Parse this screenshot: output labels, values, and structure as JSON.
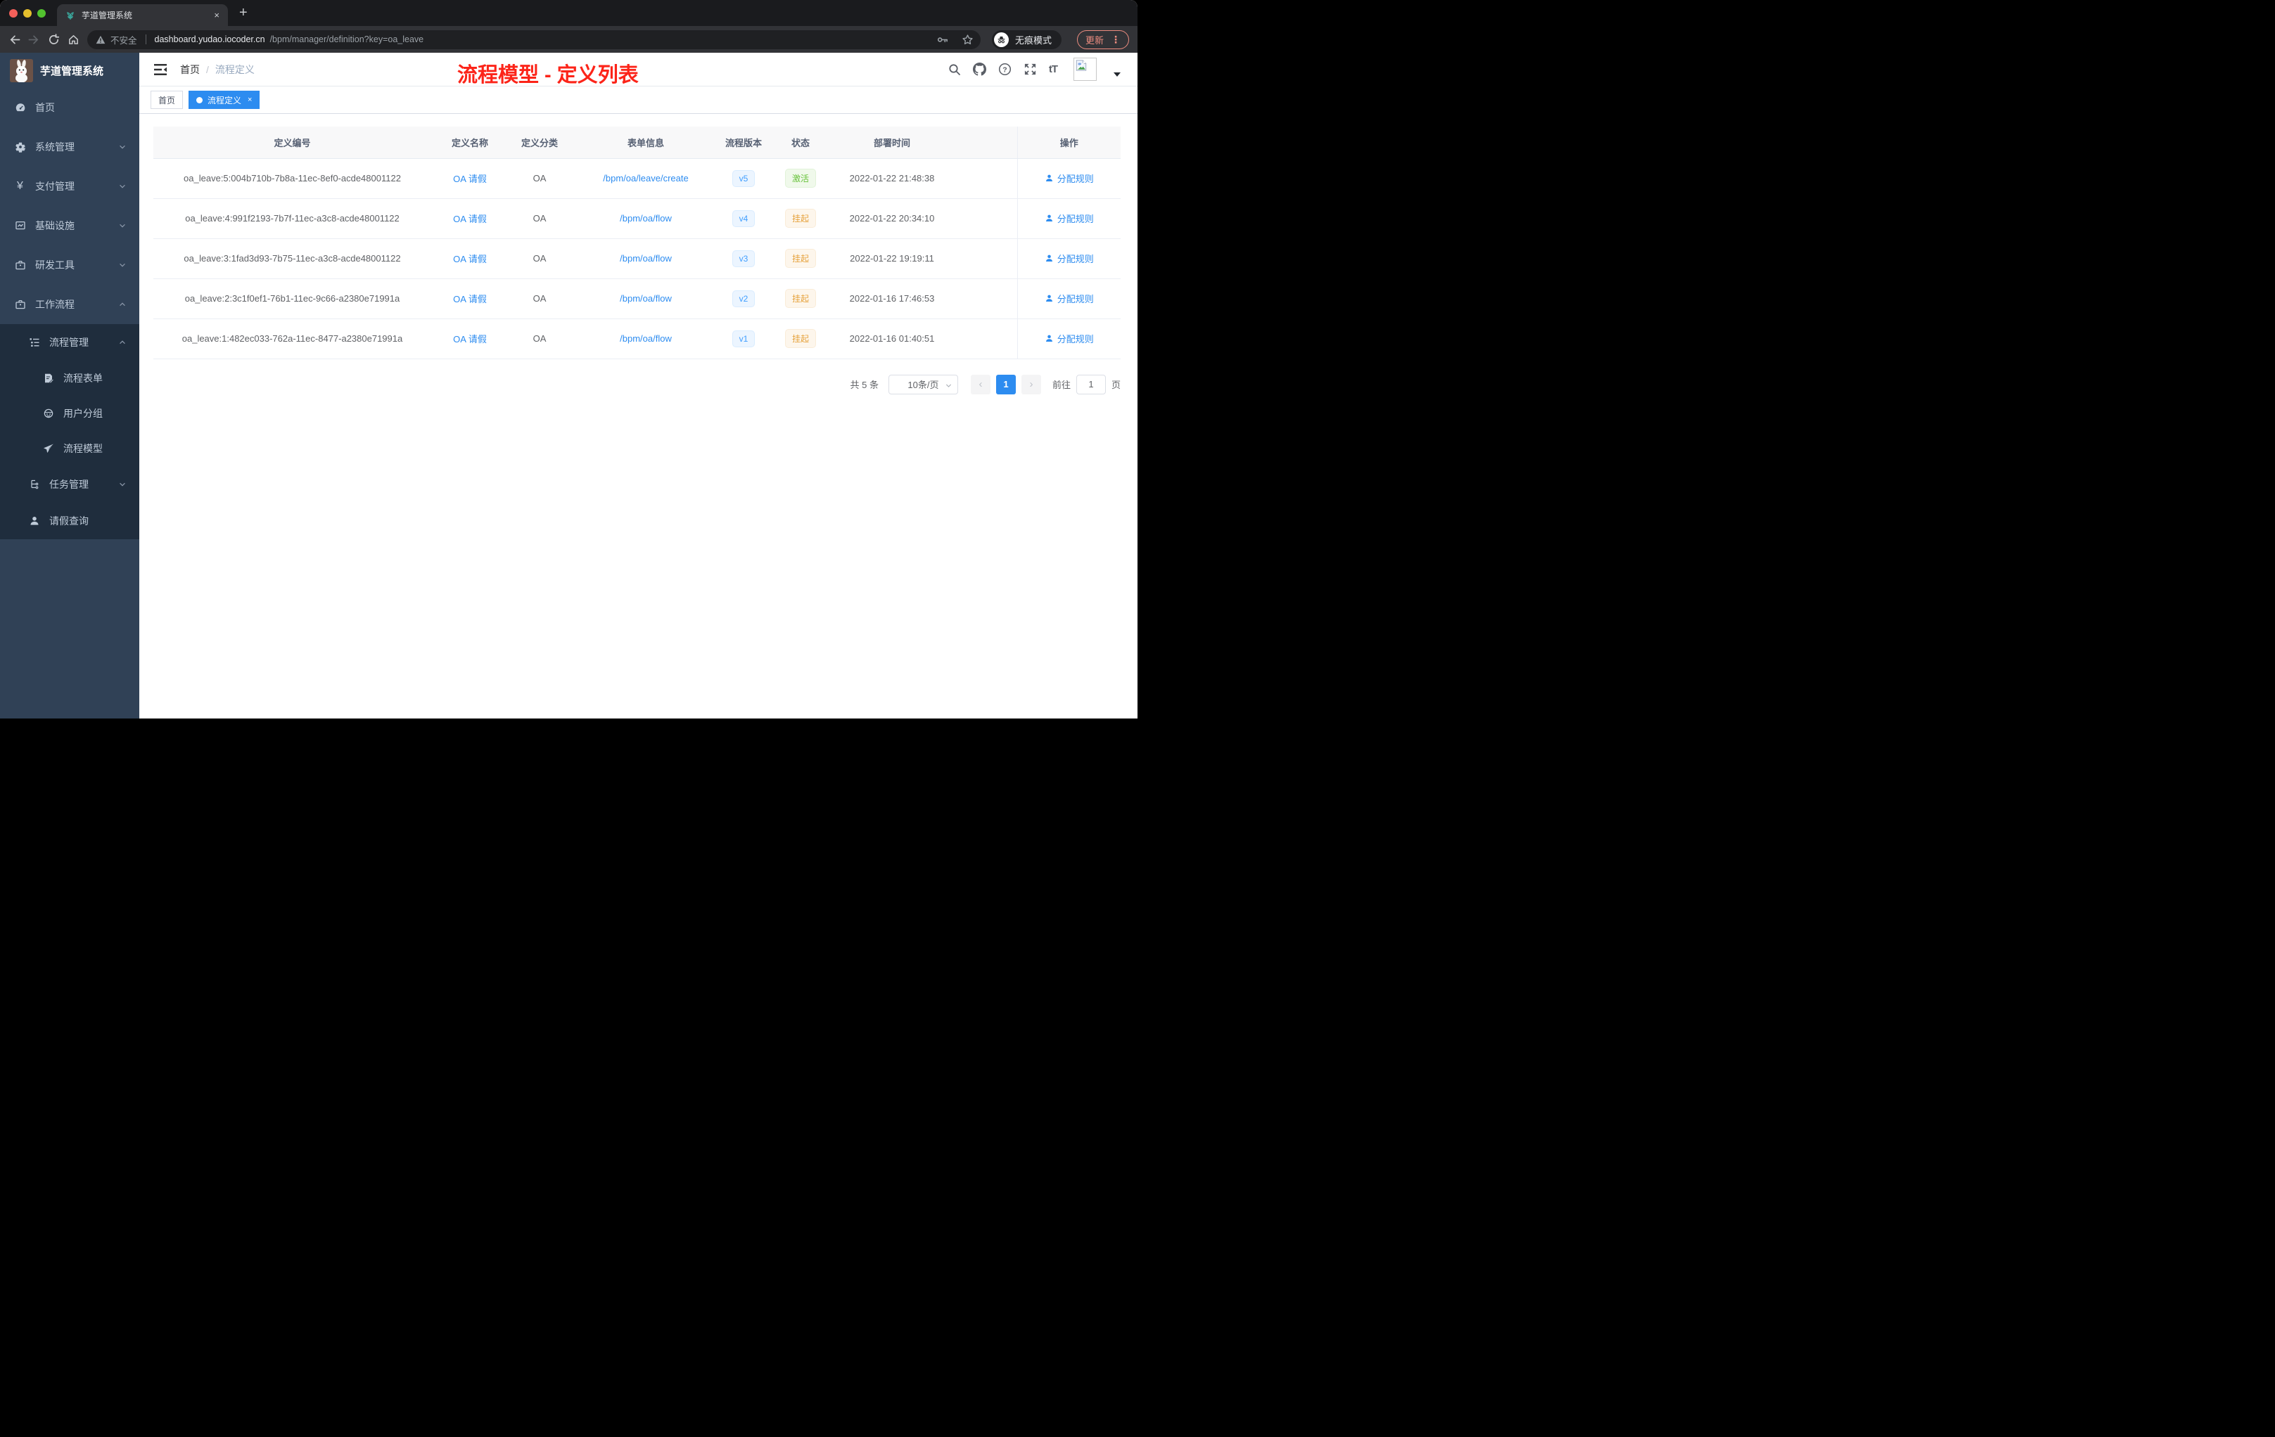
{
  "browser": {
    "tab_title": "芋道管理系统",
    "security_label": "不安全",
    "url_host": "dashboard.yudao.iocoder.cn",
    "url_path": "/bpm/manager/definition?key=oa_leave",
    "incognito_label": "无痕模式",
    "update_label": "更新"
  },
  "glyphs": {
    "tab_close": "×",
    "new_tab": "+",
    "update_menu_dots": "⋮",
    "yen": "¥",
    "font_size": "tT",
    "question": "?",
    "breadcrumb_sep": "/",
    "tag_close": "×",
    "prev": "‹",
    "next": "›"
  },
  "sidebar": {
    "logo_title": "芋道管理系统",
    "items": [
      {
        "label": "首页",
        "icon": "dashboard-icon"
      },
      {
        "label": "系统管理",
        "icon": "gear-icon"
      },
      {
        "label": "支付管理",
        "icon": "yen-icon"
      },
      {
        "label": "基础设施",
        "icon": "monitor-icon"
      },
      {
        "label": "研发工具",
        "icon": "briefcase-icon"
      },
      {
        "label": "工作流程",
        "icon": "briefcase-icon"
      },
      {
        "label": "流程管理",
        "icon": "list-icon"
      },
      {
        "label": "流程表单",
        "icon": "form-icon"
      },
      {
        "label": "用户分组",
        "icon": "user-group-icon"
      },
      {
        "label": "流程模型",
        "icon": "paper-plane-icon"
      },
      {
        "label": "任务管理",
        "icon": "tree-icon"
      },
      {
        "label": "请假查询",
        "icon": "user-icon"
      }
    ]
  },
  "header": {
    "breadcrumb_home": "首页",
    "breadcrumb_current": "流程定义",
    "annotation": "流程模型 - 定义列表"
  },
  "tags": {
    "home": "首页",
    "active": "流程定义"
  },
  "table": {
    "columns": [
      "定义编号",
      "定义名称",
      "定义分类",
      "表单信息",
      "流程版本",
      "状态",
      "部署时间",
      "操作"
    ],
    "rows": [
      {
        "id": "oa_leave:5:004b710b-7b8a-11ec-8ef0-acde48001122",
        "name": "OA 请假",
        "category": "OA",
        "form": "/bpm/oa/leave/create",
        "version": "v5",
        "status": "激活",
        "deploy_time": "2022-01-22 21:48:38",
        "action": "分配规则"
      },
      {
        "id": "oa_leave:4:991f2193-7b7f-11ec-a3c8-acde48001122",
        "name": "OA 请假",
        "category": "OA",
        "form": "/bpm/oa/flow",
        "version": "v4",
        "status": "挂起",
        "deploy_time": "2022-01-22 20:34:10",
        "action": "分配规则"
      },
      {
        "id": "oa_leave:3:1fad3d93-7b75-11ec-a3c8-acde48001122",
        "name": "OA 请假",
        "category": "OA",
        "form": "/bpm/oa/flow",
        "version": "v3",
        "status": "挂起",
        "deploy_time": "2022-01-22 19:19:11",
        "action": "分配规则"
      },
      {
        "id": "oa_leave:2:3c1f0ef1-76b1-11ec-9c66-a2380e71991a",
        "name": "OA 请假",
        "category": "OA",
        "form": "/bpm/oa/flow",
        "version": "v2",
        "status": "挂起",
        "deploy_time": "2022-01-16 17:46:53",
        "action": "分配规则"
      },
      {
        "id": "oa_leave:1:482ec033-762a-11ec-8477-a2380e71991a",
        "name": "OA 请假",
        "category": "OA",
        "form": "/bpm/oa/flow",
        "version": "v1",
        "status": "挂起",
        "deploy_time": "2022-01-16 01:40:51",
        "action": "分配规则"
      }
    ]
  },
  "pagination": {
    "total": "共 5 条",
    "page_size": "10条/页",
    "current_page": "1",
    "goto_label": "前往",
    "goto_value": "1",
    "page_unit": "页"
  },
  "colors": {
    "accent": "#2d8cf0",
    "link": "#409eff",
    "status_active": "#67c23a",
    "status_suspend": "#e6a23c",
    "annotation_red": "#fc2419",
    "sidebar_bg": "#304156",
    "submenu_bg": "#1f2d3d"
  }
}
